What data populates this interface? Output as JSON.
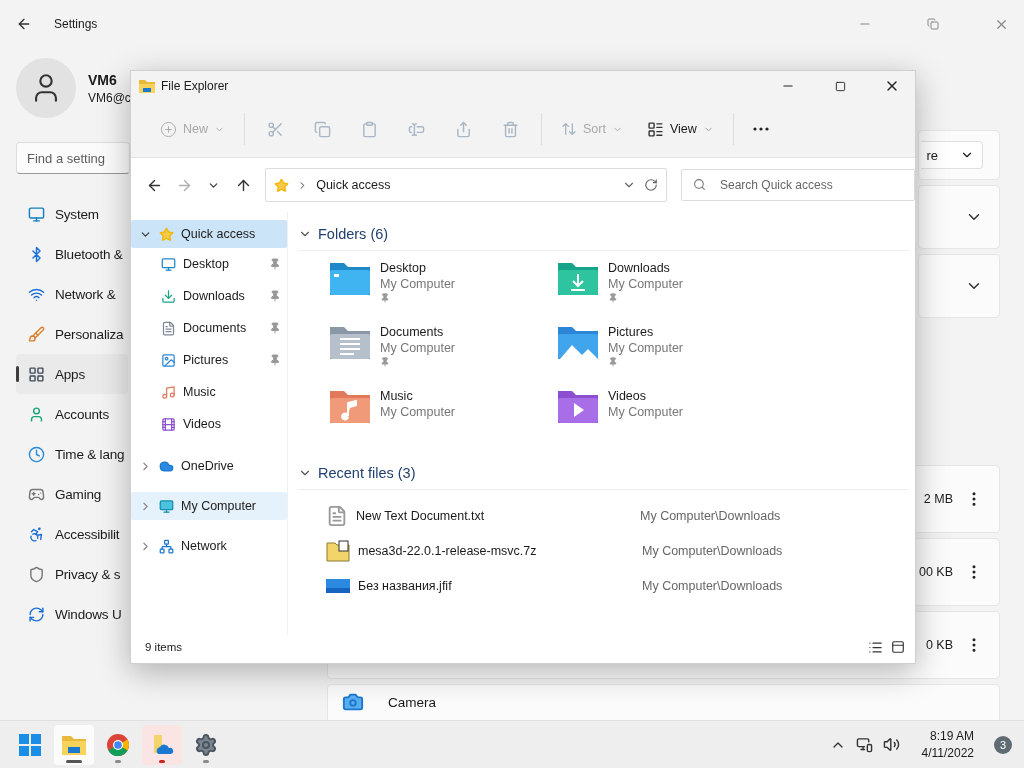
{
  "settings": {
    "title": "Settings",
    "user": {
      "name": "VM6",
      "email": "VM6@c"
    },
    "search": {
      "placeholder": "Find a setting"
    },
    "nav": [
      {
        "label": "System",
        "selected": false
      },
      {
        "label": "Bluetooth &",
        "selected": false
      },
      {
        "label": "Network &",
        "selected": false
      },
      {
        "label": "Personaliza",
        "selected": false
      },
      {
        "label": "Apps",
        "selected": true
      },
      {
        "label": "Accounts",
        "selected": false
      },
      {
        "label": "Time & lang",
        "selected": false
      },
      {
        "label": "Gaming",
        "selected": false
      },
      {
        "label": "Accessibilit",
        "selected": false
      },
      {
        "label": "Privacy & s",
        "selected": false
      },
      {
        "label": "Windows U",
        "selected": false
      }
    ],
    "cards": [
      {
        "kind": "dropdown",
        "value": "re"
      },
      {
        "kind": "expander"
      },
      {
        "kind": "expander"
      },
      {
        "kind": "app",
        "size": "2 MB"
      },
      {
        "kind": "app",
        "size": "00 KB"
      },
      {
        "kind": "app",
        "size": "0 KB"
      },
      {
        "kind": "app",
        "name": "Camera"
      }
    ]
  },
  "explorer": {
    "title": "File Explorer",
    "toolbar": {
      "new": {
        "label": "New",
        "disabled": true
      },
      "actions": [
        {
          "disabled": true
        },
        {
          "disabled": true
        },
        {
          "disabled": true
        },
        {
          "disabled": true
        },
        {
          "disabled": true
        },
        {
          "disabled": true
        }
      ],
      "sort": {
        "label": "Sort",
        "disabled": true
      },
      "view": {
        "label": "View",
        "disabled": false
      }
    },
    "nav_buttons": [
      {
        "disabled": false
      },
      {
        "disabled": true
      },
      {
        "disabled": false
      },
      {
        "disabled": false
      }
    ],
    "address": {
      "path": "Quick access"
    },
    "search": {
      "placeholder": "Search Quick access"
    },
    "tree": [
      {
        "label": "Quick access",
        "expanded": true,
        "selected": true,
        "hovered": false,
        "children": [
          {
            "label": "Desktop",
            "pinned": true,
            "selected": false
          },
          {
            "label": "Downloads",
            "pinned": true,
            "selected": false
          },
          {
            "label": "Documents",
            "pinned": true,
            "selected": false
          },
          {
            "label": "Pictures",
            "pinned": true,
            "selected": false
          },
          {
            "label": "Music",
            "pinned": false,
            "selected": false
          },
          {
            "label": "Videos",
            "pinned": false,
            "selected": false
          }
        ]
      },
      {
        "label": "OneDrive",
        "expanded": false,
        "selected": false,
        "hovered": false
      },
      {
        "label": "My Computer",
        "expanded": false,
        "selected": false,
        "hovered": true
      },
      {
        "label": "Network",
        "expanded": false,
        "selected": false,
        "hovered": false
      }
    ],
    "folders": {
      "title": "Folders (6)",
      "expanded": true,
      "items": [
        {
          "name": "Desktop",
          "location": "My Computer",
          "pinned": true
        },
        {
          "name": "Downloads",
          "location": "My Computer",
          "pinned": true
        },
        {
          "name": "Documents",
          "location": "My Computer",
          "pinned": true
        },
        {
          "name": "Pictures",
          "location": "My Computer",
          "pinned": true
        },
        {
          "name": "Music",
          "location": "My Computer",
          "pinned": false
        },
        {
          "name": "Videos",
          "location": "My Computer",
          "pinned": false
        }
      ]
    },
    "recent": {
      "title": "Recent files (3)",
      "expanded": true,
      "items": [
        {
          "name": "New Text Document.txt",
          "path": "My Computer\\Downloads"
        },
        {
          "name": "mesa3d-22.0.1-release-msvc.7z",
          "path": "My Computer\\Downloads"
        },
        {
          "name": "Без названия.jfif",
          "path": "My Computer\\Downloads"
        }
      ]
    },
    "status": "9 items"
  },
  "taskbar": {
    "apps": [
      {
        "open": false,
        "active": false,
        "attention": false
      },
      {
        "open": true,
        "active": true,
        "attention": false
      },
      {
        "open": true,
        "active": false,
        "attention": false
      },
      {
        "open": true,
        "active": false,
        "attention": true
      },
      {
        "open": true,
        "active": false,
        "attention": false
      }
    ],
    "time": "8:19 AM",
    "date": "4/11/2022",
    "notifications": "3"
  }
}
